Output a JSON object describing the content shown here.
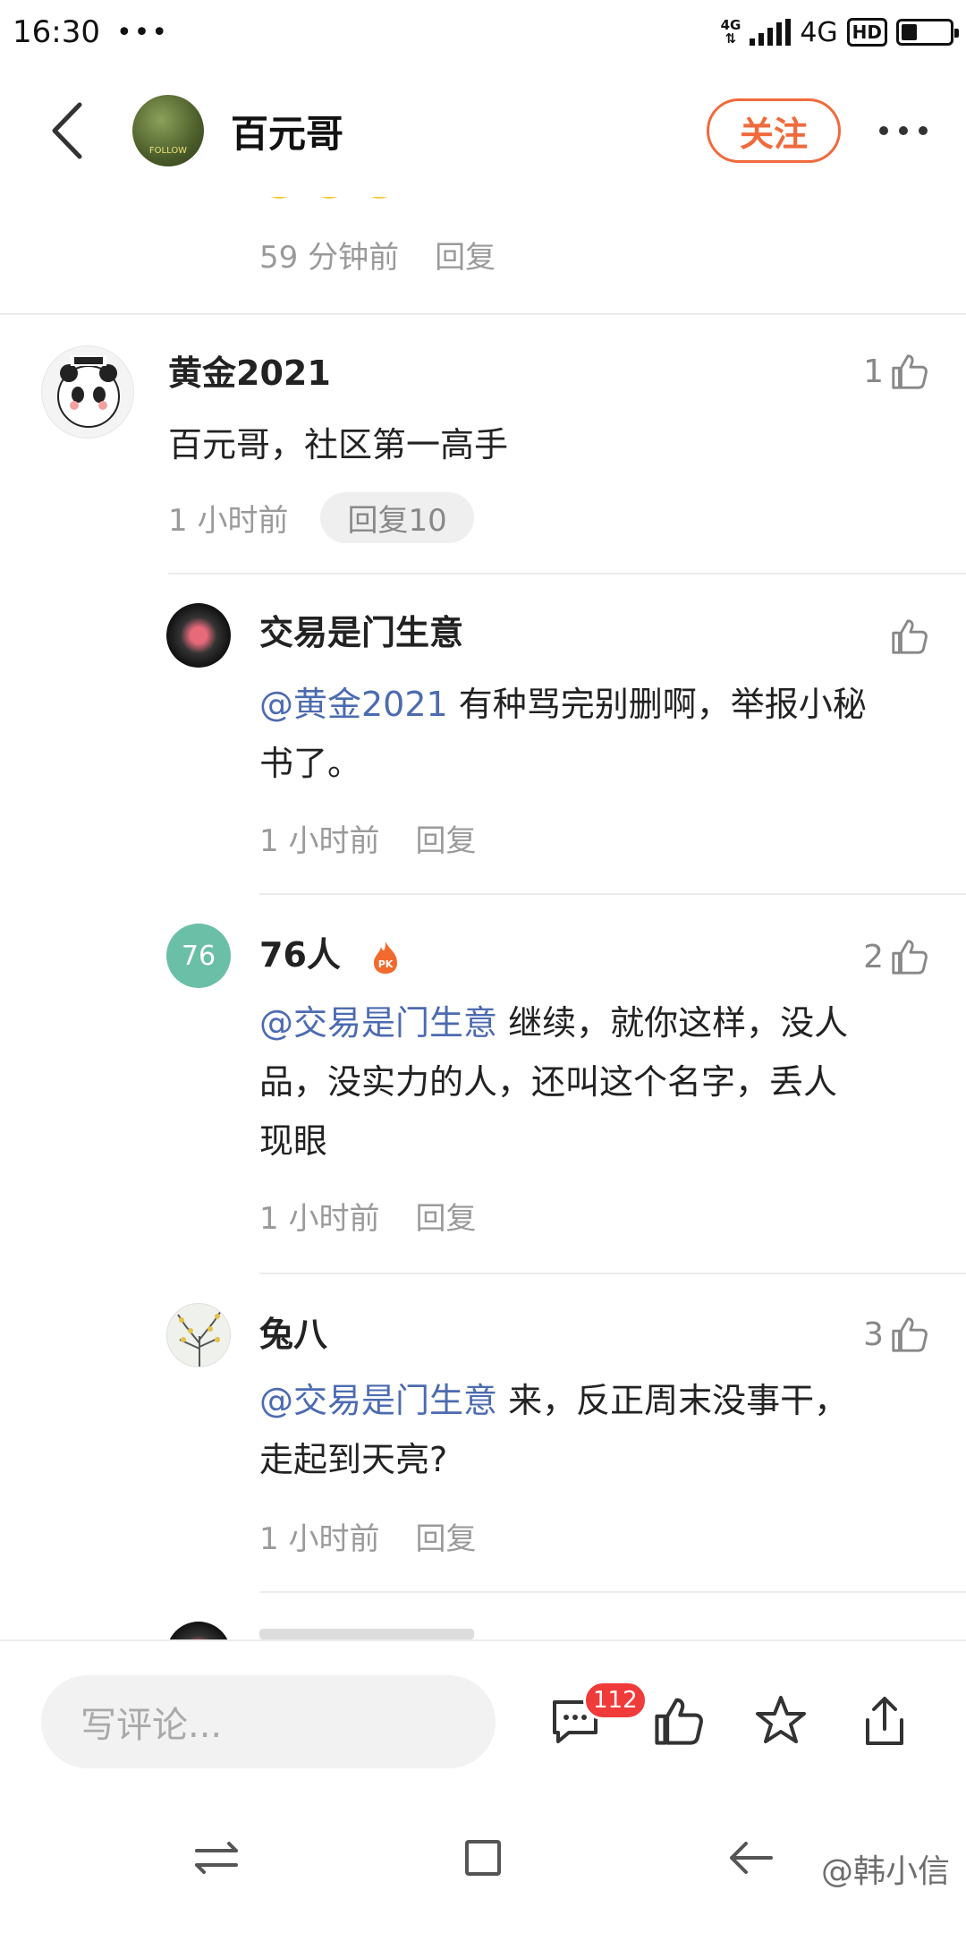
{
  "status_bar": {
    "time": "16:30",
    "dots": "•••",
    "net_small_top": "4G",
    "net_large": "4G",
    "hd": "HD"
  },
  "header": {
    "title": "百元哥",
    "follow_label": "关注"
  },
  "top_partial": {
    "time": "59 分钟前",
    "reply_label": "回复"
  },
  "comments": [
    {
      "username": "黄金2021",
      "text": "百元哥，社区第一高手",
      "time": "1 小时前",
      "reply_label": "回复10",
      "likes": "1"
    }
  ],
  "replies": [
    {
      "username": "交易是门生意",
      "mention": "@黄金2021",
      "text_line1": " 有种骂完别删啊，举报小秘",
      "text_line2": "书了。",
      "time": "1 小时前",
      "reply_label": "回复",
      "likes": ""
    },
    {
      "username": "76人",
      "avatar_text": "76",
      "mention": "@交易是门生意",
      "text_line1": " 继续，就你这样，没人",
      "text_line2": "品，没实力的人，还叫这个名字，丢人",
      "text_line3": "现眼",
      "time": "1 小时前",
      "reply_label": "回复",
      "likes": "2"
    },
    {
      "username": "兔八",
      "mention": "@交易是门生意",
      "text_line1": " 来，反正周末没事干，",
      "text_line2": "走起到天亮?",
      "time": "1 小时前",
      "reply_label": "回复",
      "likes": "3"
    }
  ],
  "bottom_bar": {
    "input_placeholder": "写评论...",
    "comment_count": "112"
  },
  "watermark": "@韩小信",
  "colors": {
    "accent": "#f06a3c",
    "mention": "#4c6bb0",
    "badge": "#f03b3b",
    "avatar76": "#6bbfa7"
  }
}
